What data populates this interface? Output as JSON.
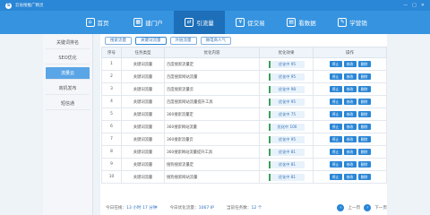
{
  "app": {
    "logo": "S",
    "title": "云省搜推广精灵"
  },
  "window": {
    "minimize": "—",
    "maximize": "□",
    "close": "✕"
  },
  "nav": [
    {
      "label": "首页",
      "icon": "⌂"
    },
    {
      "label": "建门户",
      "icon": "▦"
    },
    {
      "label": "引流量",
      "icon": "⇄"
    },
    {
      "label": "促交易",
      "icon": "¥"
    },
    {
      "label": "看数据",
      "icon": "▤"
    },
    {
      "label": "学营销",
      "icon": "✎"
    }
  ],
  "sidebar": [
    {
      "label": "关键词排名"
    },
    {
      "label": "SEO优化"
    },
    {
      "label": "流量云"
    },
    {
      "label": "商机发布"
    },
    {
      "label": "短信通"
    }
  ],
  "tabs": [
    {
      "label": "搜索流量"
    },
    {
      "label": "关键词流量"
    },
    {
      "label": "外链流量"
    },
    {
      "label": "微电商人气"
    }
  ],
  "table": {
    "headers": [
      "序号",
      "任务类型",
      "优化内容",
      "优化效果",
      "操作"
    ],
    "rows": [
      {
        "no": "1",
        "type": "关键词流量",
        "content": "百度搜索流量定",
        "status": "优化中 95"
      },
      {
        "no": "2",
        "type": "关键词流量",
        "content": "百度搜索网站流量",
        "status": "优化中 95"
      },
      {
        "no": "3",
        "type": "关键词流量",
        "content": "百度搜索流量云",
        "status": "优化中 98"
      },
      {
        "no": "4",
        "type": "关键词流量",
        "content": "百度搜索网站流量提升工具",
        "status": "优化中 95"
      },
      {
        "no": "5",
        "type": "关键词流量",
        "content": "360搜索流量定",
        "status": "优化中 75"
      },
      {
        "no": "6",
        "type": "关键词流量",
        "content": "360搜索网站流量",
        "status": "优化中 100"
      },
      {
        "no": "7",
        "type": "关键词流量",
        "content": "360搜索流量云",
        "status": "优化中 95"
      },
      {
        "no": "8",
        "type": "关键词流量",
        "content": "360搜索网站流量提升工具",
        "status": "优化中 81"
      },
      {
        "no": "9",
        "type": "关键词流量",
        "content": "搜狗搜索流量定",
        "status": "优化中 81"
      },
      {
        "no": "10",
        "type": "关键词流量",
        "content": "搜狗搜索网站流量",
        "status": "优化中 81"
      }
    ],
    "actions": [
      "停止",
      "修改",
      "删除"
    ]
  },
  "footer": {
    "online_label": "今日在线：",
    "online_value": "13 小时 17 分钟",
    "traffic_label": "今日优化流量：",
    "traffic_value": "1067 IP",
    "tasks_label": "当前任务数：",
    "tasks_value": "12 个",
    "prev": "上一页",
    "next": "下一页"
  },
  "colors": {
    "primary": "#2a86d6",
    "nav_active": "#1c6fb8",
    "status_ok": "#3aa05a"
  }
}
